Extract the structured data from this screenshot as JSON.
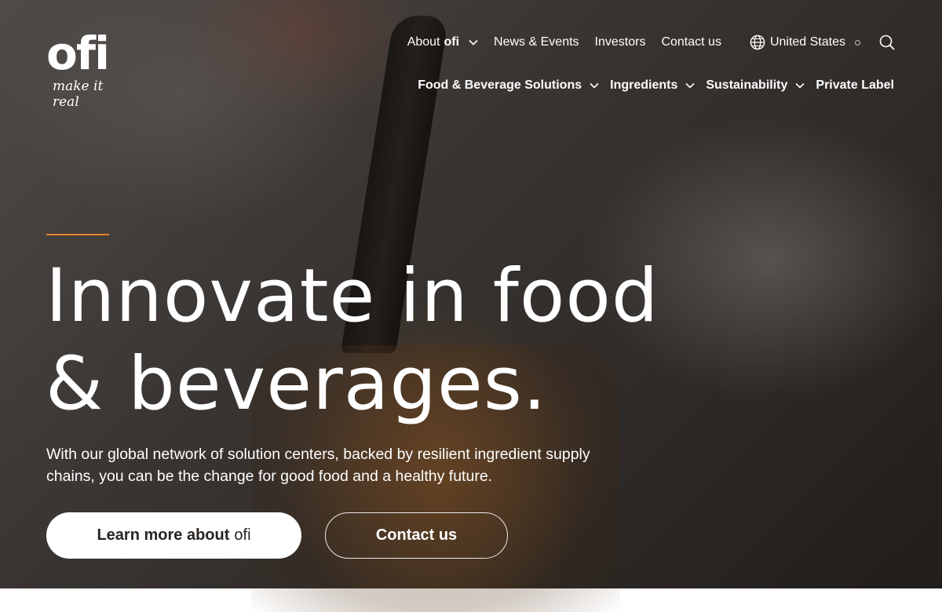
{
  "logo": {
    "mark": "ofi",
    "tagline": "make it real"
  },
  "utility_nav": {
    "about_prefix": "About",
    "about_brand": "ofi",
    "news": "News & Events",
    "investors": "Investors",
    "contact": "Contact us",
    "region": "United States"
  },
  "main_nav": {
    "items": [
      {
        "label": "Food & Beverage Solutions",
        "dropdown": true
      },
      {
        "label": "Ingredients",
        "dropdown": true
      },
      {
        "label": "Sustainability",
        "dropdown": true
      },
      {
        "label": "Private Label",
        "dropdown": false
      }
    ]
  },
  "hero": {
    "headline_line1": "Innovate in food",
    "headline_line2": "& beverages.",
    "subtext": "With our global network of solution centers, backed by resilient ingredient supply chains, you can be the change for good food and a healthy future.",
    "primary_button": {
      "label": "Learn more about",
      "brand": "ofi"
    },
    "secondary_button": {
      "label": "Contact us"
    }
  },
  "icons": {
    "globe": "globe-icon",
    "search": "search-icon",
    "chevron": "chevron-down-icon"
  },
  "colors": {
    "accent": "#e8822a",
    "text": "#ffffff",
    "button_text": "#2a2420"
  }
}
